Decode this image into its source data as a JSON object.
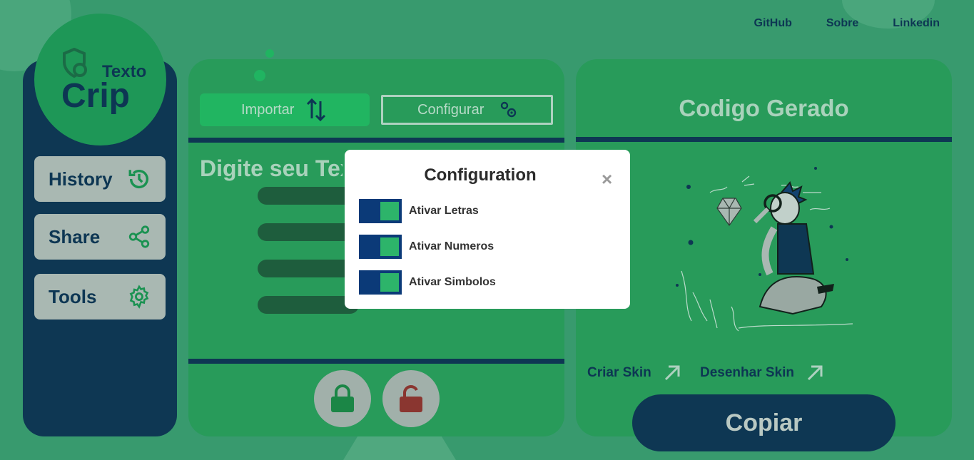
{
  "nav": {
    "links": [
      "GitHub",
      "Sobre",
      "Linkedin"
    ]
  },
  "logo": {
    "line1": "Texto",
    "line2": "Crip"
  },
  "sidebar": {
    "items": [
      {
        "label": "History",
        "icon": "history-icon"
      },
      {
        "label": "Share",
        "icon": "share-icon"
      },
      {
        "label": "Tools",
        "icon": "gear-icon"
      }
    ]
  },
  "editor": {
    "import_label": "Importar",
    "config_label": "Configurar",
    "placeholder_title": "Digite seu Texto"
  },
  "result": {
    "title": "Codigo Gerado",
    "create_skin": "Criar Skin",
    "draw_skin": "Desenhar Skin",
    "copy_label": "Copiar"
  },
  "modal": {
    "title": "Configuration",
    "close": "×",
    "options": [
      {
        "label": "Ativar Letras",
        "on": true
      },
      {
        "label": "Ativar Numeros",
        "on": true
      },
      {
        "label": "Ativar Simbolos",
        "on": true
      }
    ]
  },
  "colors": {
    "background": "#3fa476",
    "panel": "#2ba55d",
    "navy": "#0b2b55",
    "accent_green": "#23c566",
    "lock_red": "#a32a2a"
  }
}
